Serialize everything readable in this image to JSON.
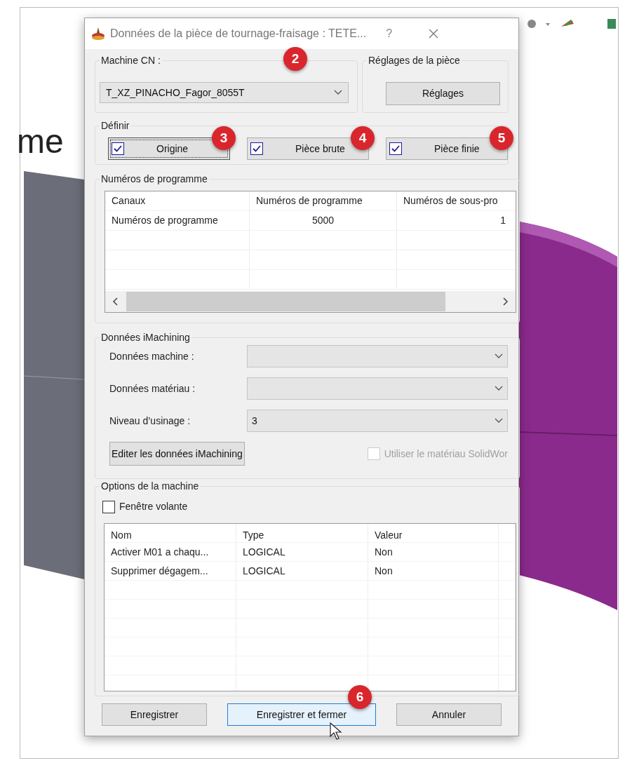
{
  "slide_text": "me",
  "dialog": {
    "title": "Données de la pièce de tournage-fraisage : TETE...",
    "help": "?"
  },
  "machine": {
    "label": "Machine CN :",
    "value": "T_XZ_PINACHO_Fagor_8055T",
    "badge": "2"
  },
  "settings": {
    "label": "Réglages de la pièce",
    "button": "Réglages"
  },
  "define": {
    "label": "Définir",
    "items": [
      {
        "label": "Origine",
        "checked": true,
        "focused": true,
        "badge": "3"
      },
      {
        "label": "Pièce brute",
        "checked": true,
        "focused": false,
        "badge": "4"
      },
      {
        "label": "Pièce finie",
        "checked": true,
        "focused": false,
        "badge": "5"
      }
    ]
  },
  "program_numbers": {
    "label": "Numéros de programme",
    "columns": [
      "Canaux",
      "Numéros de programme",
      "Numéros de sous-pro"
    ],
    "rows": [
      [
        "Numéros de programme",
        "5000",
        "1"
      ]
    ]
  },
  "imachining": {
    "label": "Données iMachining",
    "fields": [
      {
        "label": "Données machine :"
      },
      {
        "label": "Données matériau :"
      },
      {
        "label": "Niveau d’usinage :",
        "value": "3"
      }
    ],
    "edit_button": "Editer les données iMachining",
    "use_material": {
      "label": "Utiliser le matériau SolidWor",
      "checked": false,
      "disabled": true
    }
  },
  "machine_options": {
    "label": "Options de la machine",
    "floating": {
      "label": "Fenêtre volante",
      "checked": false
    },
    "columns": [
      "Nom",
      "Type",
      "Valeur"
    ],
    "rows": [
      [
        "Activer M01 a chaqu...",
        "LOGICAL",
        "Non"
      ],
      [
        "Supprimer dégagem...",
        "LOGICAL",
        "Non"
      ]
    ]
  },
  "buttons": [
    {
      "label": "Enregistrer",
      "focused": false
    },
    {
      "label": "Enregistrer et fermer",
      "focused": true,
      "badge": "6"
    },
    {
      "label": "Annuler",
      "focused": false
    }
  ]
}
